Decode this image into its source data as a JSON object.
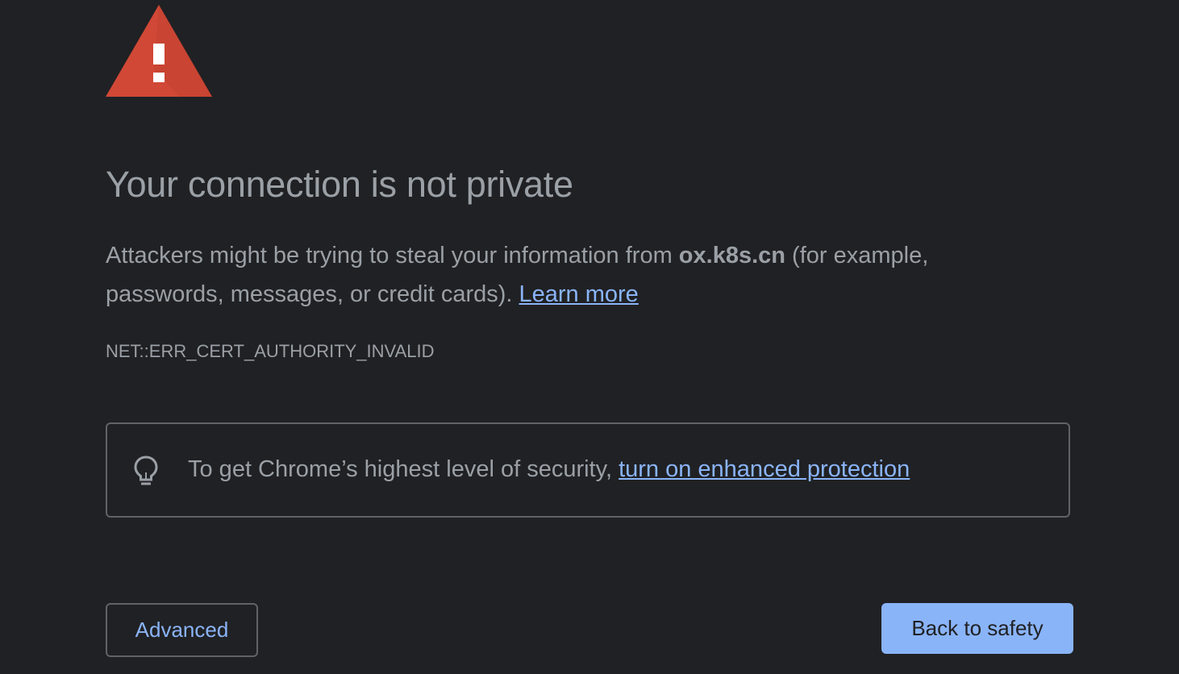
{
  "page": {
    "title": "Your connection is not private",
    "explanation_before": "Attackers might be trying to steal your information from ",
    "host": "ox.k8s.cn",
    "explanation_after": " (for example, passwords, messages, or credit cards). ",
    "learn_more": "Learn more",
    "error_code": "NET::ERR_CERT_AUTHORITY_INVALID"
  },
  "enhanced_protection": {
    "text": "To get Chrome’s highest level of security, ",
    "link": "turn on enhanced protection",
    "icon": "lightbulb-icon"
  },
  "buttons": {
    "advanced": "Advanced",
    "back_to_safety": "Back to safety"
  },
  "icons": {
    "warning": "warning-triangle-icon"
  },
  "colors": {
    "background": "#202124",
    "text": "#9aa0a6",
    "link": "#8ab4f8",
    "warning_red": "#d14836",
    "primary_button": "#8ab4f8"
  }
}
